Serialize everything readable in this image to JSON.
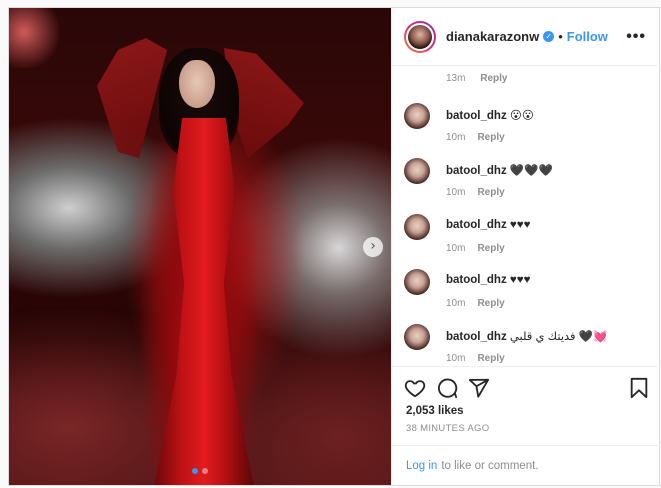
{
  "post": {
    "dots": [
      {
        "active": true
      },
      {
        "active": false
      }
    ],
    "next_icon": "chevron-right-icon"
  },
  "header": {
    "username": "dianakarazonw",
    "verified_icon": "verified-badge-icon",
    "separator": "•",
    "follow_label": "Follow",
    "more_icon": "more-options-icon",
    "more_glyph": "•••"
  },
  "comments": {
    "first_meta": {
      "time": "13m",
      "reply": "Reply"
    },
    "items": [
      {
        "user": "batool_dhz",
        "text": "😮😮",
        "time": "10m",
        "reply": "Reply"
      },
      {
        "user": "batool_dhz",
        "text": "🖤🖤🖤",
        "time": "10m",
        "reply": "Reply"
      },
      {
        "user": "batool_dhz",
        "text": "♥♥♥",
        "time": "10m",
        "reply": "Reply"
      },
      {
        "user": "batool_dhz",
        "text": "♥♥♥",
        "time": "10m",
        "reply": "Reply"
      },
      {
        "user": "batool_dhz",
        "text": "فديتك ي قلبي 🖤💓",
        "time": "10m",
        "reply": "Reply"
      }
    ]
  },
  "actions": {
    "like_icon": "heart-icon",
    "comment_icon": "comment-icon",
    "share_icon": "share-icon",
    "save_icon": "bookmark-icon"
  },
  "likes_text": "2,053 likes",
  "time_ago": "38 MINUTES AGO",
  "login": {
    "link": "Log in",
    "rest": "to like or comment."
  },
  "colors": {
    "accent": "#3897f0",
    "muted": "#8e8e8e",
    "text": "#262626",
    "border": "#dbdbdb"
  }
}
